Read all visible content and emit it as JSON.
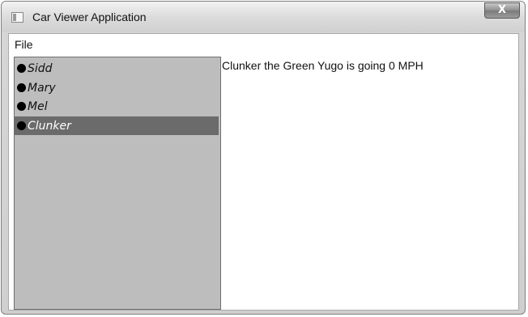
{
  "window": {
    "title": "Car Viewer Application",
    "close_label": "X"
  },
  "menu": {
    "file_label": "File"
  },
  "car_list": {
    "items": [
      {
        "name": "Sidd",
        "selected": false
      },
      {
        "name": "Mary",
        "selected": false
      },
      {
        "name": "Mel",
        "selected": false
      },
      {
        "name": "Clunker",
        "selected": true
      }
    ]
  },
  "detail": {
    "text": "Clunker the Green Yugo is going 0 MPH"
  },
  "colors": {
    "list_background": "#bdbdbd",
    "selection_background": "#6b6b6b"
  }
}
